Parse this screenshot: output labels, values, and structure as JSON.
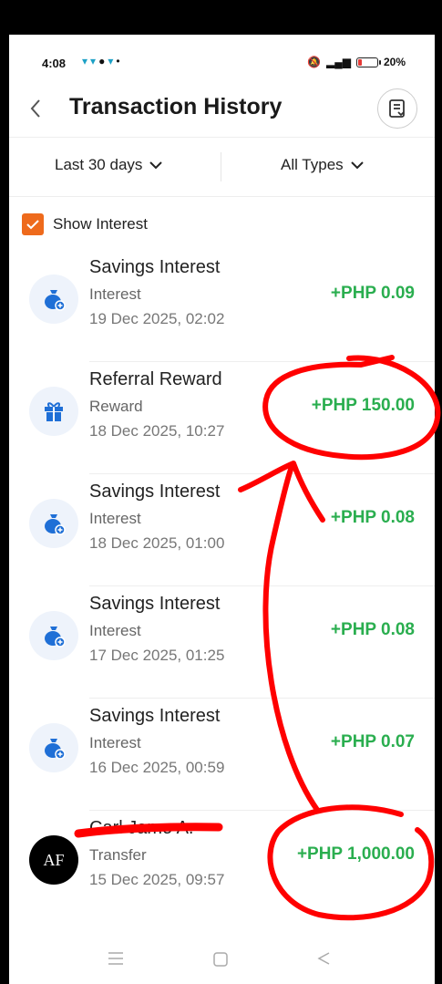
{
  "status_bar": {
    "time": "4:08",
    "battery": "20%",
    "battery_level": 0.2,
    "left_icons": [
      "app-notification-icon",
      "app-notification-icon",
      "messenger-icon",
      "app-notification-icon",
      "dot-icon"
    ],
    "right_icons": [
      "mute-icon",
      "signal-icon"
    ]
  },
  "header": {
    "title": "Transaction History",
    "back_icon": "chevron-left-icon",
    "action_icon": "statement-icon"
  },
  "filters": {
    "date_range": "Last 30 days",
    "type": "All Types"
  },
  "show_interest": {
    "label": "Show Interest",
    "checked": true
  },
  "transactions": [
    {
      "name": "Savings Interest",
      "type": "Interest",
      "date": "19 Dec 2025, 02:02",
      "amount": "+PHP 0.09",
      "icon": "savings-jar-icon"
    },
    {
      "name": "Referral Reward",
      "type": "Reward",
      "date": "18 Dec 2025, 10:27",
      "amount": "+PHP 150.00",
      "icon": "gift-icon"
    },
    {
      "name": "Savings Interest",
      "type": "Interest",
      "date": "18 Dec 2025, 01:00",
      "amount": "+PHP 0.08",
      "icon": "savings-jar-icon"
    },
    {
      "name": "Savings Interest",
      "type": "Interest",
      "date": "17 Dec 2025, 01:25",
      "amount": "+PHP 0.08",
      "icon": "savings-jar-icon"
    },
    {
      "name": "Savings Interest",
      "type": "Interest",
      "date": "16 Dec 2025, 00:59",
      "amount": "+PHP 0.07",
      "icon": "savings-jar-icon"
    },
    {
      "name": "Carl Jamo A.",
      "type": "Transfer",
      "date": "15 Dec 2025, 09:57",
      "amount": "+PHP 1,000.00",
      "icon": "avatar",
      "avatar_initials": "AF"
    }
  ],
  "colors": {
    "accent": "#ee6a1c",
    "positive_amount": "#2aae4f",
    "icon_blue": "#1f6fd6",
    "annotation_red": "#ff0000"
  },
  "navigation_bar": [
    "menu-icon",
    "home-icon",
    "back-icon"
  ]
}
